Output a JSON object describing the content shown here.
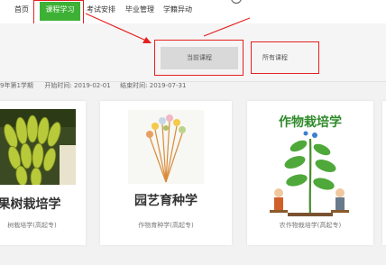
{
  "nav": {
    "items": [
      {
        "label": "首页"
      },
      {
        "label": "课程学习"
      },
      {
        "label": "考试安排"
      },
      {
        "label": "毕业管理"
      },
      {
        "label": "学籍异动"
      }
    ]
  },
  "tabs": {
    "current": "当前课程",
    "all": "所有课程"
  },
  "term": {
    "name": "9年第1学期",
    "start_label": "开始时间:",
    "start": "2019-02-01",
    "end_label": "结束时间:",
    "end": "2019-07-31"
  },
  "courses": [
    {
      "title": "果树栽培学",
      "subtitle": "树栽培学(高起专)"
    },
    {
      "title": "园艺育种学",
      "subtitle": "作物育种学(高起专)"
    },
    {
      "title": "作物栽培学",
      "image_title": "作物栽培学",
      "subtitle": "农作物栽培学(高起专)"
    }
  ],
  "colors": {
    "accent": "#3db135",
    "highlight": "#e62020"
  }
}
